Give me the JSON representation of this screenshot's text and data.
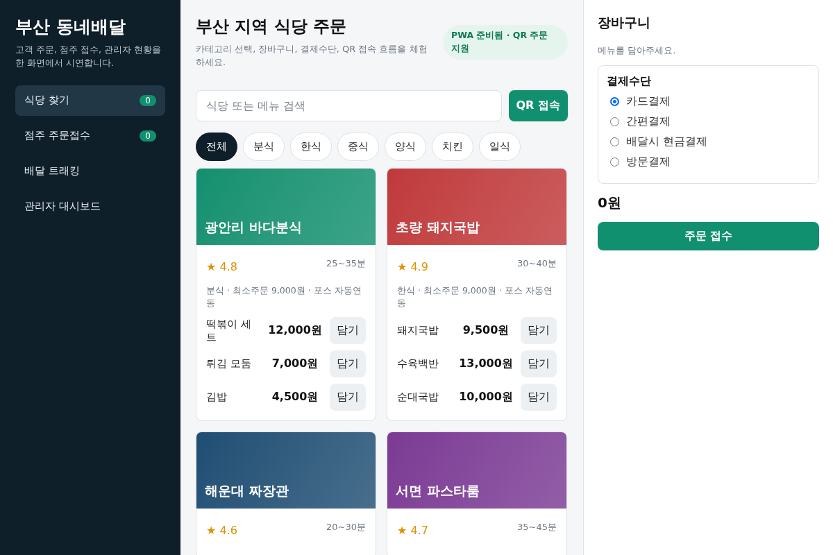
{
  "sidebar": {
    "title": "부산 동네배달",
    "subtitle": "고객 주문, 점주 접수, 관리자 현황을 한 화면에서 시연합니다.",
    "items": [
      {
        "label": "식당 찾기",
        "badge": "0",
        "selected": true
      },
      {
        "label": "점주 주문접수",
        "badge": "0",
        "selected": false
      },
      {
        "label": "배달 트래킹",
        "selected": false
      },
      {
        "label": "관리자 대시보드",
        "selected": false
      }
    ]
  },
  "main": {
    "title": "부산 지역 식당 주문",
    "subtitle": "카테고리 선택, 장바구니, 결제수단, QR 접속 흐름을 체험하세요.",
    "status_pill": "PWA 준비됨 · QR 주문 지원",
    "search": {
      "placeholder": "식당 또는 메뉴 검색"
    },
    "qr_button": "QR 접속",
    "categories": [
      {
        "label": "전체",
        "selected": true
      },
      {
        "label": "분식",
        "selected": false
      },
      {
        "label": "한식",
        "selected": false
      },
      {
        "label": "중식",
        "selected": false
      },
      {
        "label": "양식",
        "selected": false
      },
      {
        "label": "치킨",
        "selected": false
      },
      {
        "label": "일식",
        "selected": false
      }
    ],
    "restaurants": [
      {
        "name": "광안리 바다분식",
        "color": "#11906f",
        "rating": "★ 4.8",
        "time": "25~35분",
        "meta": "분식 · 최소주문 9,000원 · 포스 자동연동",
        "menu": [
          {
            "name": "떡볶이 세트",
            "price": "12,000원",
            "button": "담기"
          },
          {
            "name": "튀김 모둠",
            "price": "7,000원",
            "button": "담기"
          },
          {
            "name": "김밥",
            "price": "4,500원",
            "button": "담기"
          }
        ]
      },
      {
        "name": "초량 돼지국밥",
        "color": "#c0393b",
        "rating": "★ 4.9",
        "time": "30~40분",
        "meta": "한식 · 최소주문 9,000원 · 포스 자동연동",
        "menu": [
          {
            "name": "돼지국밥",
            "price": "9,500원",
            "button": "담기"
          },
          {
            "name": "수육백반",
            "price": "13,000원",
            "button": "담기"
          },
          {
            "name": "순대국밥",
            "price": "10,000원",
            "button": "담기"
          }
        ]
      },
      {
        "name": "해운대 짜장관",
        "color": "#1f4e73",
        "rating": "★ 4.6",
        "time": "20~30분"
      },
      {
        "name": "서면 파스타룸",
        "color": "#7b3a94",
        "rating": "★ 4.7",
        "time": "35~45분"
      }
    ]
  },
  "cart": {
    "title": "장바구니",
    "empty_text": "메뉴를 담아주세요.",
    "payment": {
      "title": "결제수단",
      "options": [
        {
          "label": "카드결제",
          "selected": true
        },
        {
          "label": "간편결제",
          "selected": false
        },
        {
          "label": "배달시 현금결제",
          "selected": false
        },
        {
          "label": "방문결제",
          "selected": false
        }
      ]
    },
    "total": "0원",
    "order_button": "주문 접수"
  }
}
